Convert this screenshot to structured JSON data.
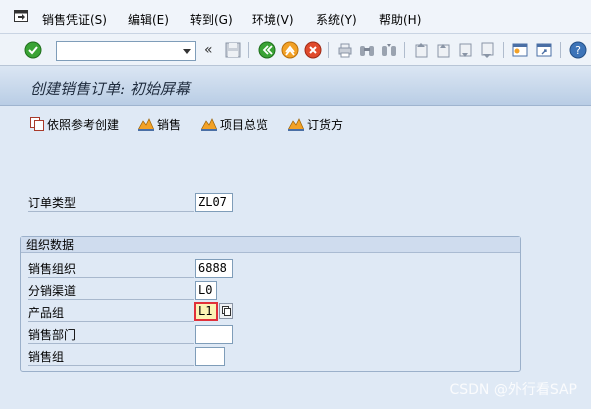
{
  "menubar": {
    "items": [
      "销售凭证(S)",
      "编辑(E)",
      "转到(G)",
      "环境(V)",
      "系统(Y)",
      "帮助(H)"
    ]
  },
  "toolbar": {
    "command_value": "",
    "back_chevron": "«"
  },
  "title": "创建销售订单: 初始屏幕",
  "app_toolbar": {
    "create_with_ref": "依照参考创建",
    "sales": "销售",
    "item_overview": "项目总览",
    "ordering_party": "订货方"
  },
  "form": {
    "order_type_label": "订单类型",
    "order_type_value": "ZL07",
    "org_group_title": "组织数据",
    "sales_org_label": "销售组织",
    "sales_org_value": "6888",
    "dist_channel_label": "分销渠道",
    "dist_channel_value": "L0",
    "division_label": "产品组",
    "division_value": "L1",
    "sales_office_label": "销售部门",
    "sales_office_value": "",
    "sales_group_label": "销售组",
    "sales_group_value": ""
  },
  "watermark": "CSDN @外行看SAP"
}
